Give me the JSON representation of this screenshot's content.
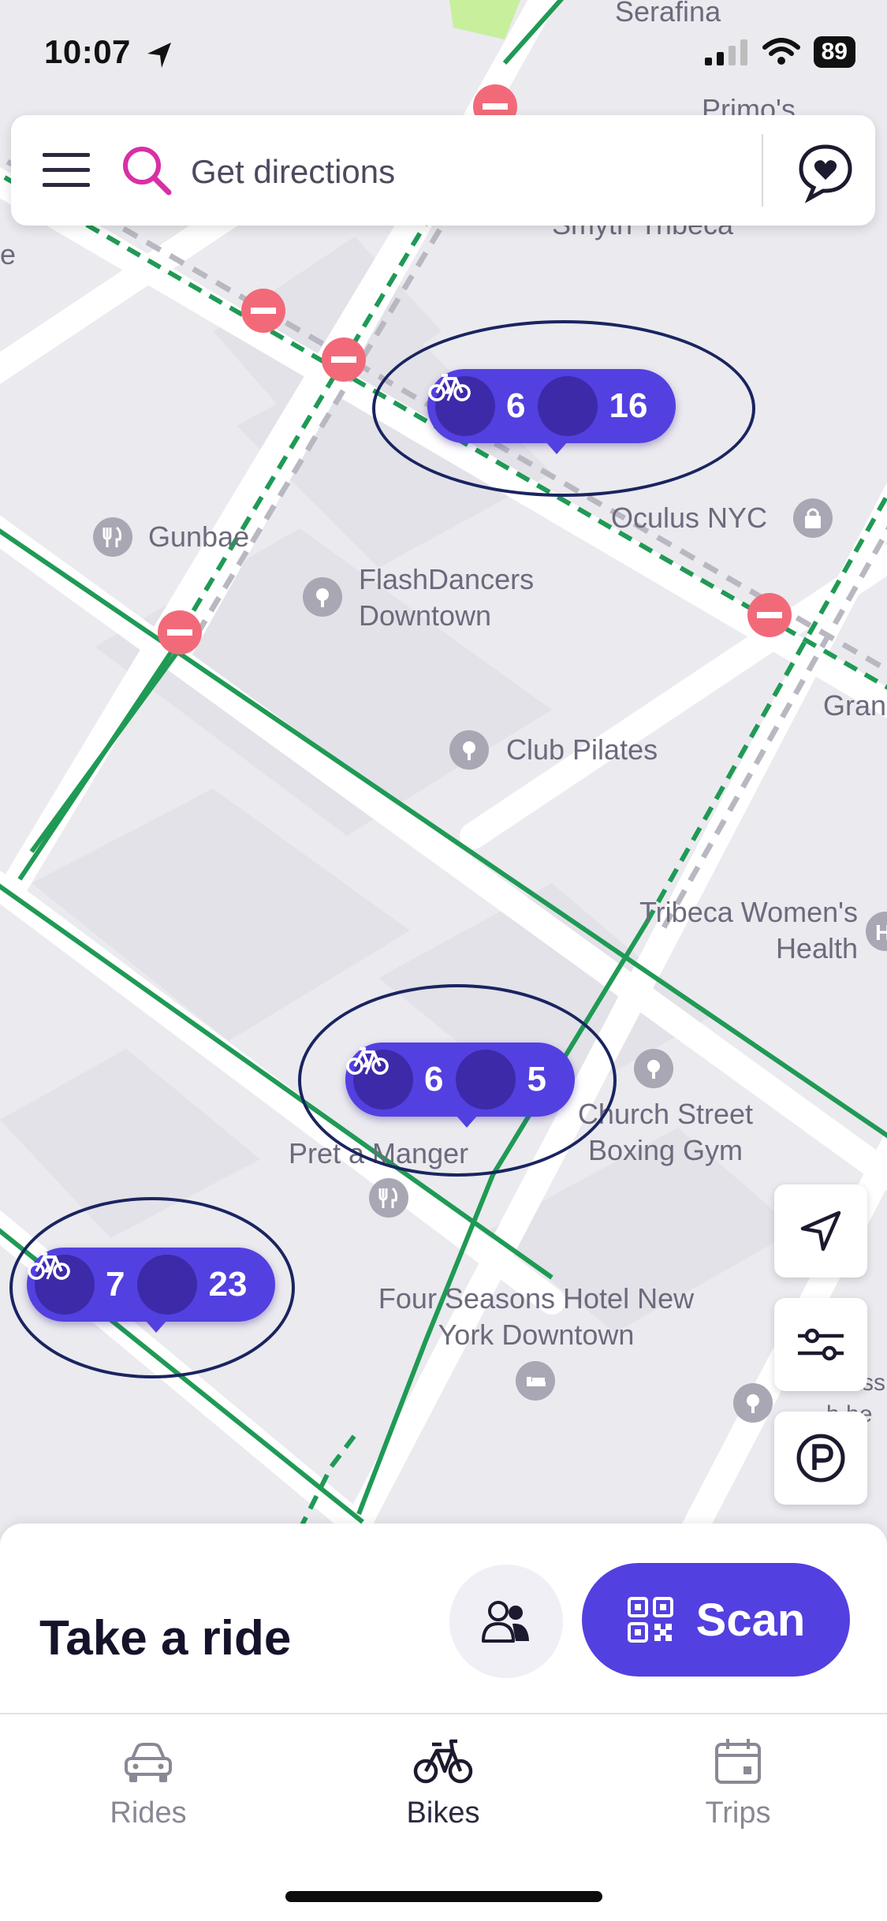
{
  "status_bar": {
    "time": "10:07",
    "battery": "89"
  },
  "search": {
    "placeholder": "Get directions"
  },
  "map_labels": {
    "serafina": "Serafina",
    "primos": "Primo's",
    "smyth": "Smyth Tribeca",
    "gunbae": "Gunbae",
    "flashdancers": "FlashDancers Downtown",
    "oculus": "Oculus NYC",
    "club_pilates": "Club Pilates",
    "gran": "Gran",
    "tribeca_health": "Tribeca Women's Health",
    "church_street": "Church Street Boxing Gym",
    "pret": "Pret a Manger",
    "four_seasons": "Four Seasons Hotel New York Downtown",
    "edge_left": "e",
    "edge_right": "Class b he"
  },
  "stations": [
    {
      "ebikes": "6",
      "bikes": "16"
    },
    {
      "ebikes": "6",
      "bikes": "5"
    },
    {
      "ebikes": "7",
      "bikes": "23"
    }
  ],
  "panel": {
    "title": "Take a ride",
    "scan_label": "Scan"
  },
  "tabs": [
    {
      "label": "Rides"
    },
    {
      "label": "Bikes"
    },
    {
      "label": "Trips"
    }
  ],
  "colors": {
    "accent": "#5340e0",
    "bike_lane": "#1f9a55",
    "search_icon": "#d92fa6"
  }
}
